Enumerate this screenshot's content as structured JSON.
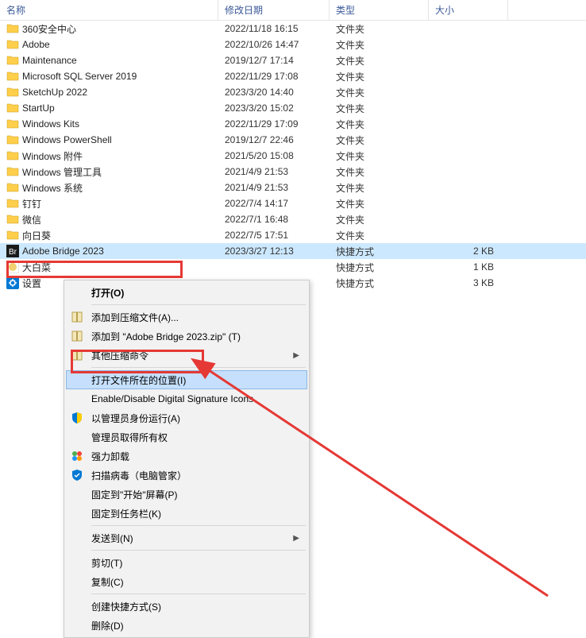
{
  "columns": {
    "name": "名称",
    "date": "修改日期",
    "type": "类型",
    "size": "大小"
  },
  "files": [
    {
      "name": "360安全中心",
      "date": "2022/11/18 16:15",
      "type": "文件夹",
      "size": "",
      "icon": "folder"
    },
    {
      "name": "Adobe",
      "date": "2022/10/26 14:47",
      "type": "文件夹",
      "size": "",
      "icon": "folder"
    },
    {
      "name": "Maintenance",
      "date": "2019/12/7 17:14",
      "type": "文件夹",
      "size": "",
      "icon": "folder"
    },
    {
      "name": "Microsoft SQL Server 2019",
      "date": "2022/11/29 17:08",
      "type": "文件夹",
      "size": "",
      "icon": "folder"
    },
    {
      "name": "SketchUp 2022",
      "date": "2023/3/20 14:40",
      "type": "文件夹",
      "size": "",
      "icon": "folder"
    },
    {
      "name": "StartUp",
      "date": "2023/3/20 15:02",
      "type": "文件夹",
      "size": "",
      "icon": "folder"
    },
    {
      "name": "Windows Kits",
      "date": "2022/11/29 17:09",
      "type": "文件夹",
      "size": "",
      "icon": "folder"
    },
    {
      "name": "Windows PowerShell",
      "date": "2019/12/7 22:46",
      "type": "文件夹",
      "size": "",
      "icon": "folder"
    },
    {
      "name": "Windows 附件",
      "date": "2021/5/20 15:08",
      "type": "文件夹",
      "size": "",
      "icon": "folder"
    },
    {
      "name": "Windows 管理工具",
      "date": "2021/4/9 21:53",
      "type": "文件夹",
      "size": "",
      "icon": "folder"
    },
    {
      "name": "Windows 系统",
      "date": "2021/4/9 21:53",
      "type": "文件夹",
      "size": "",
      "icon": "folder"
    },
    {
      "name": "钉钉",
      "date": "2022/7/4 14:17",
      "type": "文件夹",
      "size": "",
      "icon": "folder"
    },
    {
      "name": "微信",
      "date": "2022/7/1 16:48",
      "type": "文件夹",
      "size": "",
      "icon": "folder"
    },
    {
      "name": "向日葵",
      "date": "2022/7/5 17:51",
      "type": "文件夹",
      "size": "",
      "icon": "folder"
    },
    {
      "name": "Adobe Bridge 2023",
      "date": "2023/3/27 12:13",
      "type": "快捷方式",
      "size": "2 KB",
      "icon": "bridge",
      "selected": true
    },
    {
      "name": "大白菜",
      "date": "",
      "type": "快捷方式",
      "size": "1 KB",
      "icon": "dbc"
    },
    {
      "name": "设置",
      "date": "",
      "type": "快捷方式",
      "size": "3 KB",
      "icon": "settings"
    }
  ],
  "menu": [
    {
      "label": "打开(O)",
      "bold": true
    },
    {
      "sep": true
    },
    {
      "label": "添加到压缩文件(A)...",
      "icon": "zip"
    },
    {
      "label": "添加到 \"Adobe Bridge 2023.zip\" (T)",
      "icon": "zip"
    },
    {
      "label": "其他压缩命令",
      "icon": "zip",
      "arrow": true
    },
    {
      "sep": true
    },
    {
      "label": "打开文件所在的位置(I)",
      "highlighted": true
    },
    {
      "label": "Enable/Disable Digital Signature Icons"
    },
    {
      "label": "以管理员身份运行(A)",
      "icon": "shield"
    },
    {
      "label": "管理员取得所有权"
    },
    {
      "label": "强力卸载",
      "icon": "uninstall"
    },
    {
      "label": "扫描病毒（电脑管家）",
      "icon": "antivirus"
    },
    {
      "label": "固定到\"开始\"屏幕(P)"
    },
    {
      "label": "固定到任务栏(K)"
    },
    {
      "sep": true
    },
    {
      "label": "发送到(N)",
      "arrow": true
    },
    {
      "sep": true
    },
    {
      "label": "剪切(T)"
    },
    {
      "label": "复制(C)"
    },
    {
      "sep": true
    },
    {
      "label": "创建快捷方式(S)"
    },
    {
      "label": "删除(D)"
    }
  ]
}
